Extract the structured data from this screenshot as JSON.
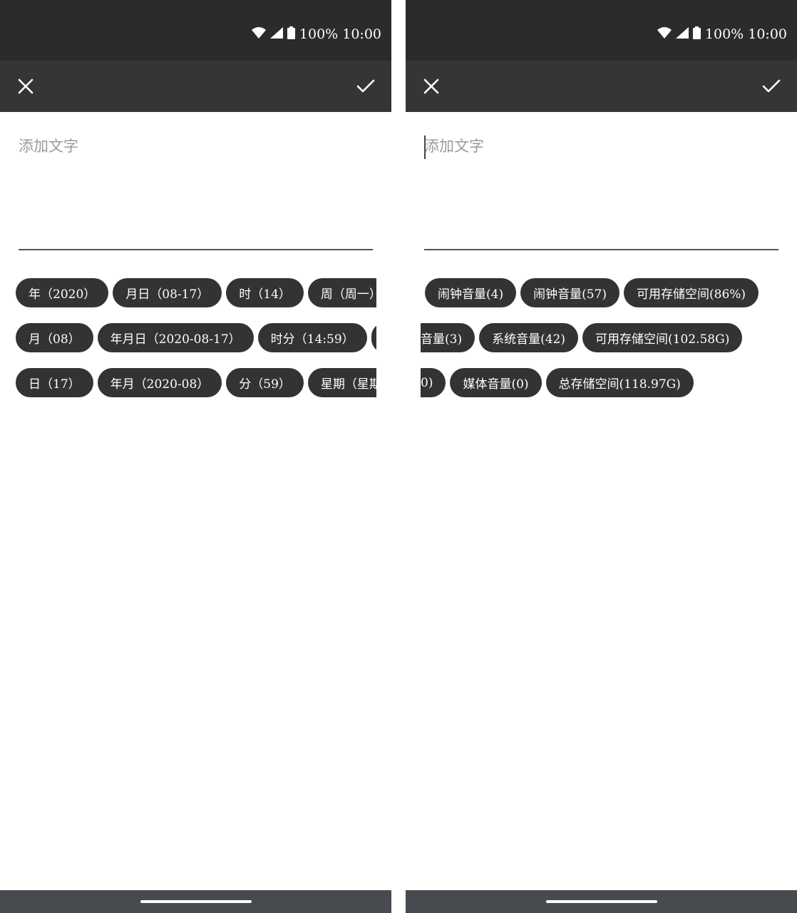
{
  "status_bar": {
    "battery_text": "100%",
    "time": "10:00"
  },
  "icons": {
    "wifi": "wifi-icon",
    "signal": "signal-icon",
    "battery": "battery-icon",
    "close": "close-icon",
    "check": "check-icon"
  },
  "colors": {
    "status_bg": "#2b2b2c",
    "toolbar_bg": "#353536",
    "chip_bg": "#333334",
    "nav_bg": "#474a4f"
  },
  "left_screen": {
    "input": {
      "placeholder": "添加文字",
      "value": ""
    },
    "chip_rows": [
      [
        "年（2020）",
        "月日（08-17）",
        "时（14）",
        "周（周一）"
      ],
      [
        "月（08）",
        "年月日（2020-08-17）",
        "时分（14:59）",
        ""
      ],
      [
        "日（17）",
        "年月（2020-08）",
        "分（59）",
        "星期（星期"
      ]
    ]
  },
  "right_screen": {
    "input": {
      "placeholder": "添加文字",
      "value": ""
    },
    "chip_rows": [
      [
        "闹钟音量(4)",
        "闹钟音量(57)",
        "可用存储空间(86%)"
      ],
      [
        "音量(3)",
        "系统音量(42)",
        "可用存储空间(102.58G)"
      ],
      [
        "0)",
        "媒体音量(0)",
        "总存储空间(118.97G)"
      ]
    ]
  }
}
